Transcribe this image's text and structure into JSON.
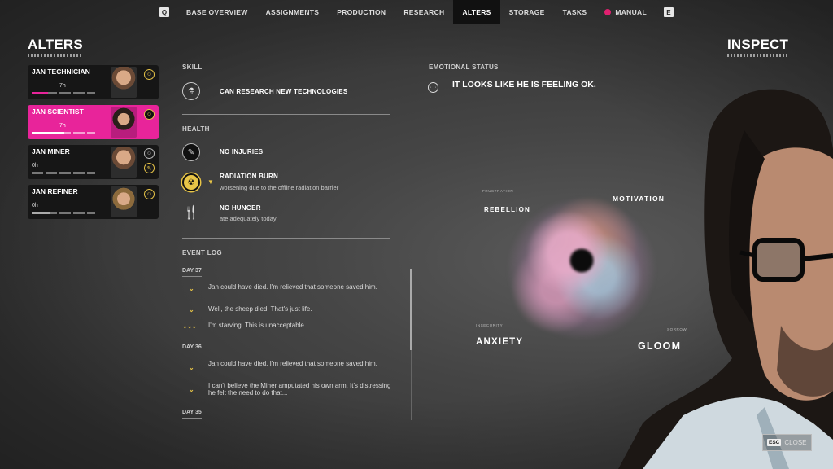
{
  "nav": {
    "left_key": "Q",
    "right_key": "E",
    "items": [
      "BASE OVERVIEW",
      "ASSIGNMENTS",
      "PRODUCTION",
      "RESEARCH",
      "ALTERS",
      "STORAGE",
      "TASKS",
      "MANUAL"
    ],
    "active": "ALTERS"
  },
  "left_title": "ALTERS",
  "right_title": "INSPECT",
  "alters": [
    {
      "name": "JAN TECHNICIAN",
      "hours": "7h",
      "active": false,
      "progress": 0.55,
      "accent": "#e8249a"
    },
    {
      "name": "JAN SCIENTIST",
      "hours": "7h",
      "active": true,
      "progress": 0.55,
      "accent": "#e8249a"
    },
    {
      "name": "JAN MINER",
      "hours": "0h",
      "active": false,
      "progress": 0.0,
      "accent": "#777777"
    },
    {
      "name": "JAN REFINER",
      "hours": "0h",
      "active": false,
      "progress": 0.3,
      "accent": "#aaaaaa"
    }
  ],
  "skill": {
    "label": "SKILL",
    "icon": "microscope-icon",
    "text": "CAN RESEARCH NEW TECHNOLOGIES"
  },
  "health": {
    "label": "HEALTH",
    "items": [
      {
        "icon": "bandage-icon",
        "title": "NO INJURIES",
        "sub": ""
      },
      {
        "icon": "radiation-icon",
        "title": "RADIATION BURN",
        "sub": "worsening due to the offline radiation barrier"
      },
      {
        "icon": "fork-knife-icon",
        "title": "NO HUNGER",
        "sub": "ate adequately today"
      }
    ]
  },
  "event_log": {
    "label": "EVENT LOG",
    "days": [
      {
        "day": "DAY 37",
        "entries": [
          {
            "chevrons": "⌄",
            "text": "Jan could have died. I'm relieved that someone saved him."
          },
          {
            "chevrons": "⌄",
            "text": "Well, the sheep died. That's just life."
          },
          {
            "chevrons": "⌄⌄⌄",
            "text": "I'm starving. This is unacceptable."
          }
        ]
      },
      {
        "day": "DAY 36",
        "entries": [
          {
            "chevrons": "⌄",
            "text": "Jan could have died. I'm relieved that someone saved him."
          },
          {
            "chevrons": "⌄",
            "text": "I can't believe the Miner amputated his own arm. It's distressing he felt the need to do that..."
          }
        ]
      },
      {
        "day": "DAY 35",
        "entries": []
      }
    ]
  },
  "emotional": {
    "label": "EMOTIONAL STATUS",
    "text": "IT LOOKS LIKE HE IS FEELING OK.",
    "icon": "neutral-face-icon"
  },
  "emotion_map": {
    "frustration": "FRUSTRATION",
    "rebellion": "REBELLION",
    "motivation": "MOTIVATION",
    "insecurity": "INSECURITY",
    "anxiety": "ANXIETY",
    "gloom": "GLOOM",
    "sorrow": "SORROW"
  },
  "close": {
    "key": "ESC",
    "label": "CLOSE"
  }
}
